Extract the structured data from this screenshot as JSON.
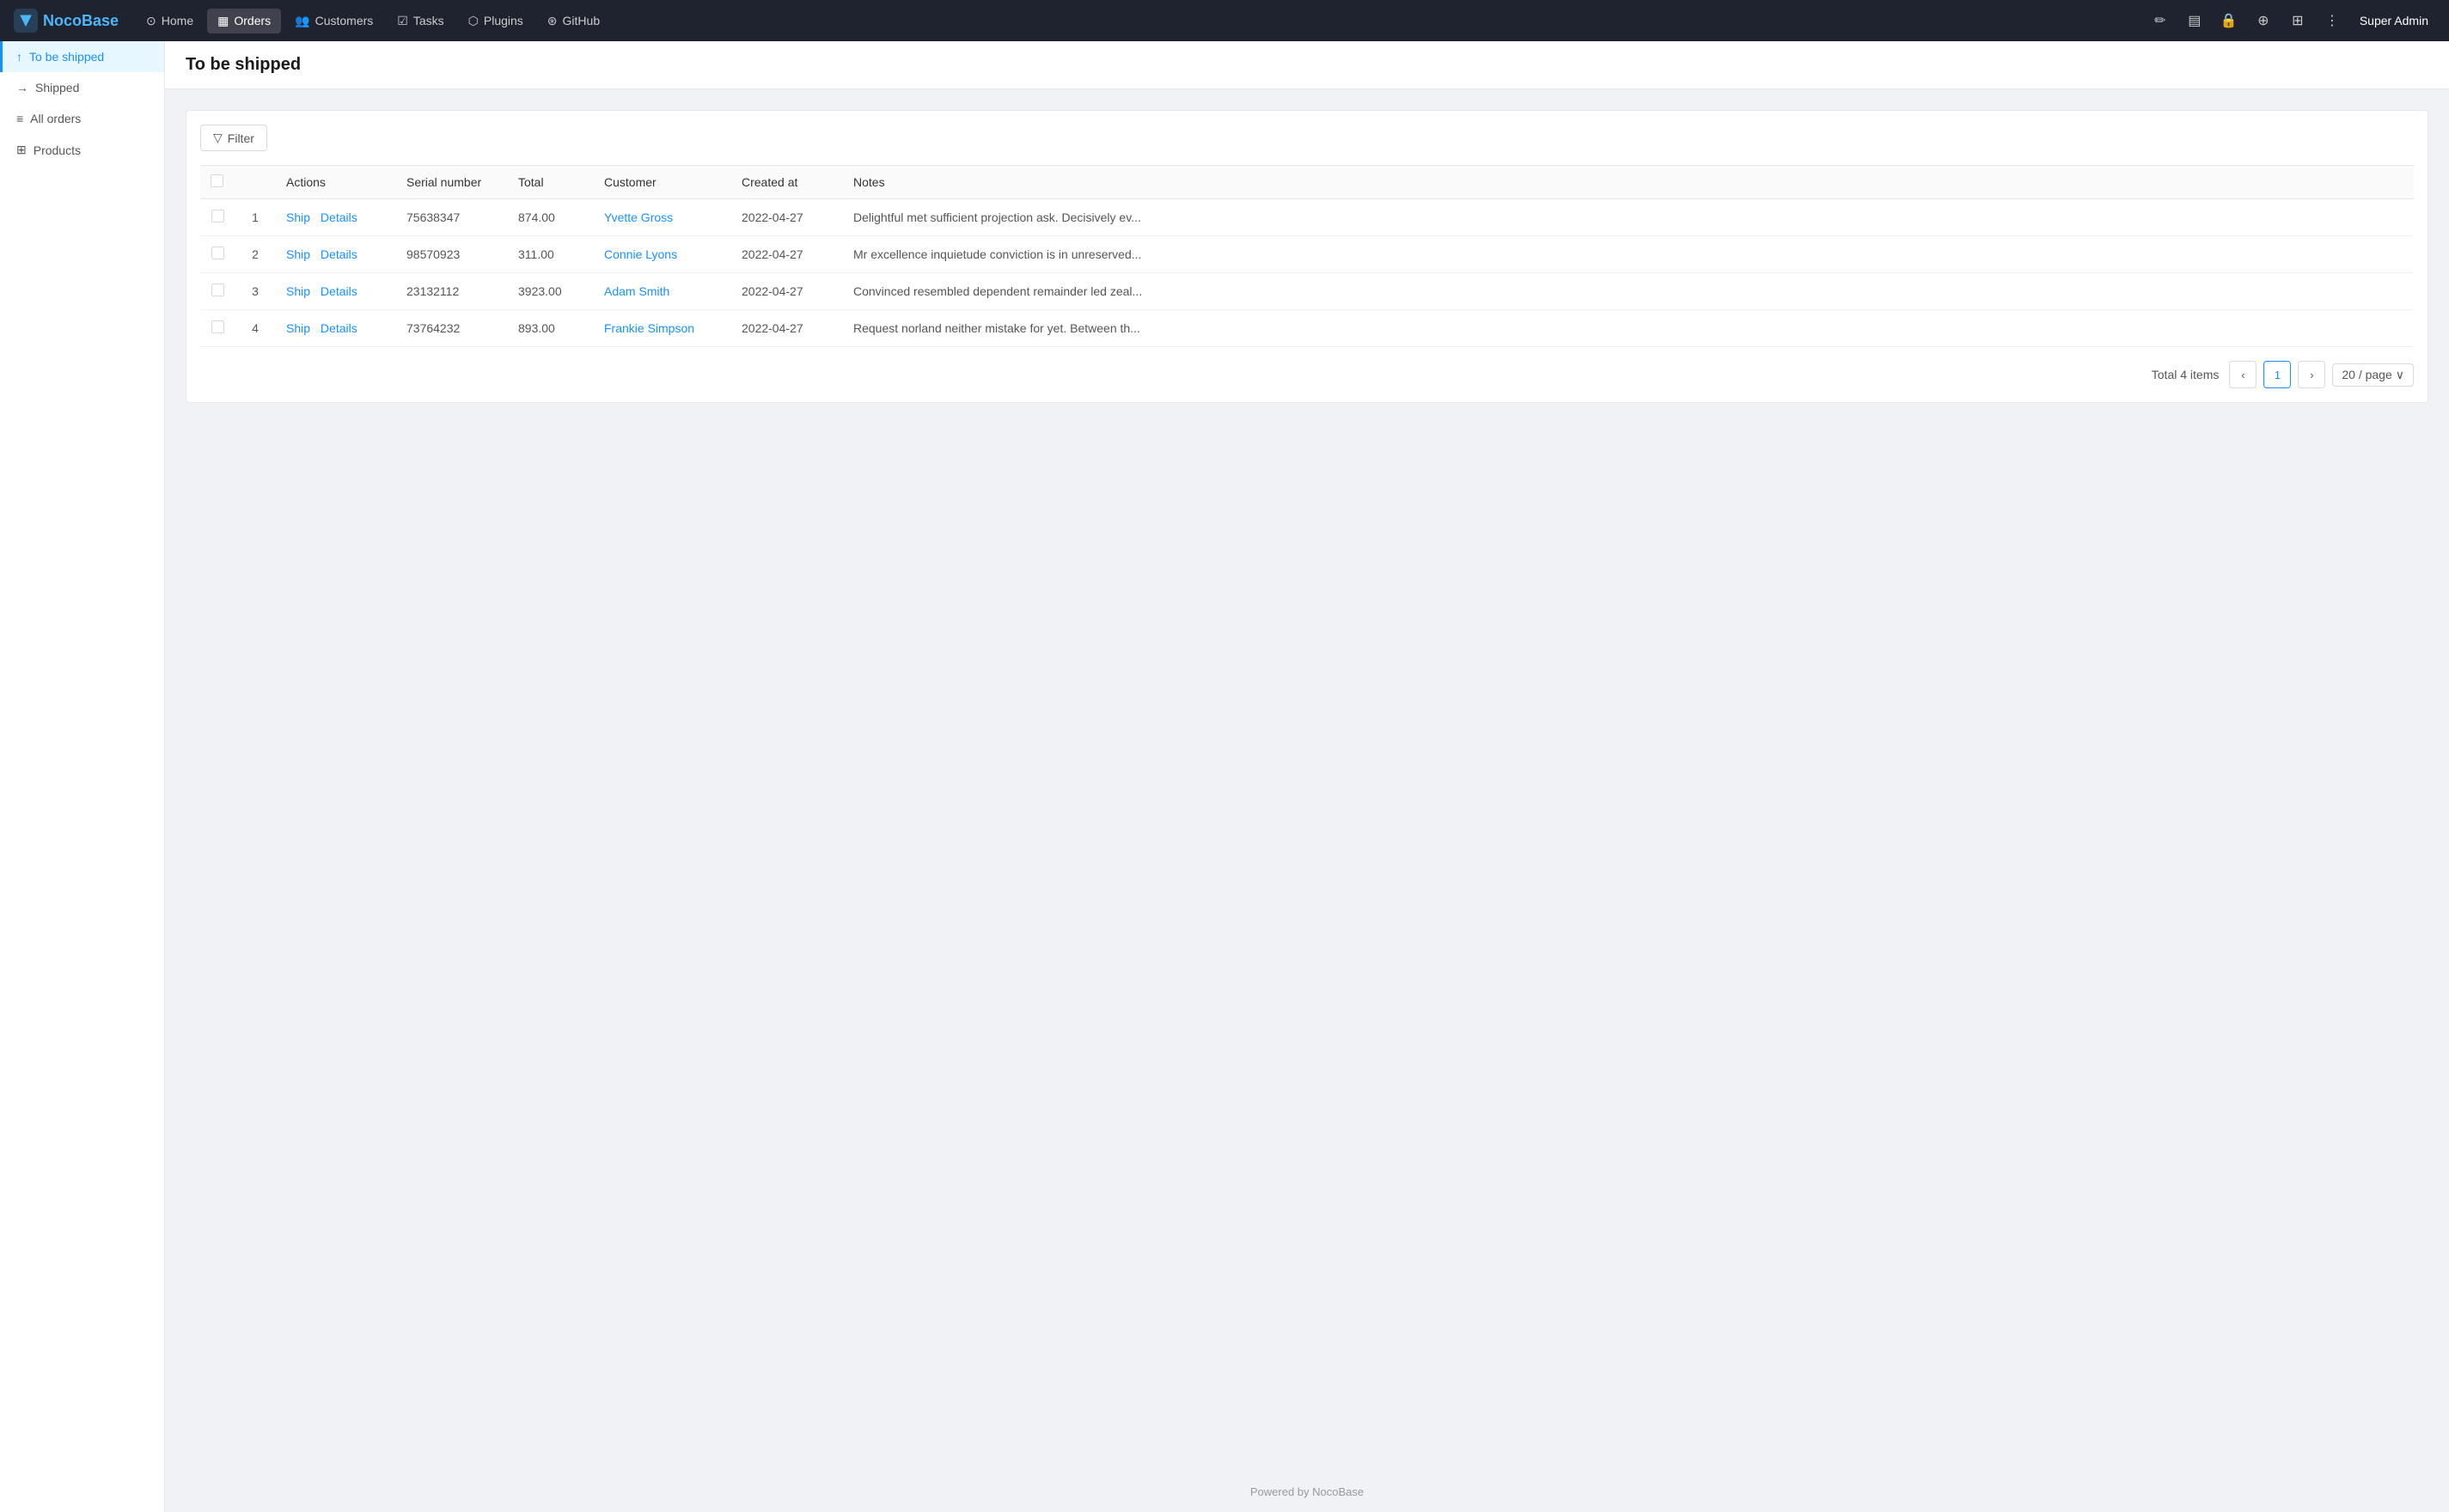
{
  "brand": {
    "name_part1": "Noco",
    "name_part2": "Base"
  },
  "topnav": {
    "items": [
      {
        "id": "home",
        "label": "Home",
        "icon": "⊙",
        "active": false
      },
      {
        "id": "orders",
        "label": "Orders",
        "icon": "▦",
        "active": true
      },
      {
        "id": "customers",
        "label": "Customers",
        "icon": "👥",
        "active": false
      },
      {
        "id": "tasks",
        "label": "Tasks",
        "icon": "☑",
        "active": false
      },
      {
        "id": "plugins",
        "label": "Plugins",
        "icon": "⬡",
        "active": false
      },
      {
        "id": "github",
        "label": "GitHub",
        "icon": "⊛",
        "active": false
      }
    ],
    "user": "Super Admin"
  },
  "sidebar": {
    "items": [
      {
        "id": "to-be-shipped",
        "label": "To be shipped",
        "icon": "↑",
        "active": true
      },
      {
        "id": "shipped",
        "label": "Shipped",
        "icon": "→",
        "active": false
      },
      {
        "id": "all-orders",
        "label": "All orders",
        "icon": "≡",
        "active": false
      },
      {
        "id": "products",
        "label": "Products",
        "icon": "⊞",
        "active": false
      }
    ]
  },
  "page": {
    "title": "To be shipped"
  },
  "filter": {
    "label": "Filter"
  },
  "table": {
    "columns": [
      {
        "id": "actions",
        "label": "Actions"
      },
      {
        "id": "serial",
        "label": "Serial number"
      },
      {
        "id": "total",
        "label": "Total"
      },
      {
        "id": "customer",
        "label": "Customer"
      },
      {
        "id": "created_at",
        "label": "Created at"
      },
      {
        "id": "notes",
        "label": "Notes"
      }
    ],
    "rows": [
      {
        "index": 1,
        "serial": "75638347",
        "total": "874.00",
        "customer": "Yvette Gross",
        "created_at": "2022-04-27",
        "notes": "Delightful met sufficient projection ask. Decisively ev...",
        "ship_label": "Ship",
        "details_label": "Details"
      },
      {
        "index": 2,
        "serial": "98570923",
        "total": "311.00",
        "customer": "Connie Lyons",
        "created_at": "2022-04-27",
        "notes": "Mr excellence inquietude conviction is in unreserved...",
        "ship_label": "Ship",
        "details_label": "Details"
      },
      {
        "index": 3,
        "serial": "23132112",
        "total": "3923.00",
        "customer": "Adam Smith",
        "created_at": "2022-04-27",
        "notes": "Convinced resembled dependent remainder led zeal...",
        "ship_label": "Ship",
        "details_label": "Details"
      },
      {
        "index": 4,
        "serial": "73764232",
        "total": "893.00",
        "customer": "Frankie Simpson",
        "created_at": "2022-04-27",
        "notes": "Request norland neither mistake for yet. Between th...",
        "ship_label": "Ship",
        "details_label": "Details"
      }
    ]
  },
  "pagination": {
    "total_label": "Total 4 items",
    "current_page": "1",
    "per_page": "20 / page"
  },
  "footer": {
    "text": "Powered by NocoBase"
  }
}
